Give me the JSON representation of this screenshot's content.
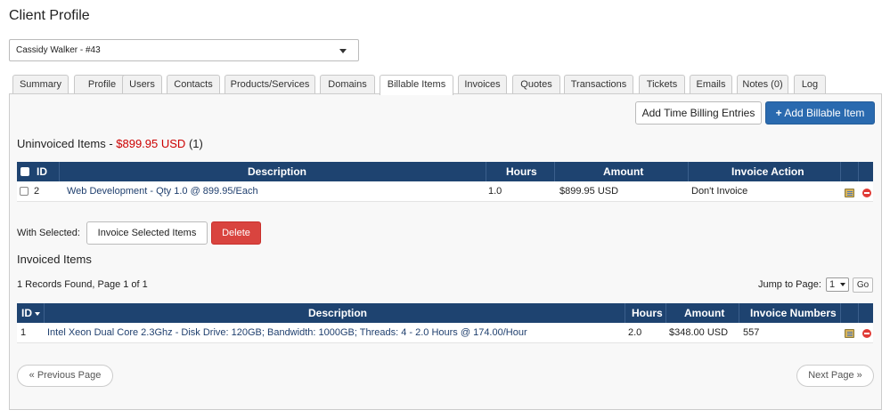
{
  "page_title": "Client Profile",
  "client_selector": {
    "value": "Cassidy Walker - #43"
  },
  "tabs": [
    {
      "label": "Summary"
    },
    {
      "label": "Profile"
    },
    {
      "label": "Users"
    },
    {
      "label": "Contacts"
    },
    {
      "label": "Products/Services"
    },
    {
      "label": "Domains"
    },
    {
      "label": "Billable Items",
      "active": true
    },
    {
      "label": "Invoices"
    },
    {
      "label": "Quotes"
    },
    {
      "label": "Transactions"
    },
    {
      "label": "Tickets"
    },
    {
      "label": "Emails"
    },
    {
      "label": "Notes (0)"
    },
    {
      "label": "Log"
    }
  ],
  "toolbar": {
    "add_time_billing_label": "Add Time Billing Entries",
    "add_billable_item_label": "Add Billable Item",
    "add_billable_item_icon": "plus-icon"
  },
  "uninvoiced": {
    "title": "Uninvoiced Items - ",
    "amount": "$899.95 USD",
    "count": "(1)",
    "columns": {
      "id": "ID",
      "description": "Description",
      "hours": "Hours",
      "amount": "Amount",
      "action": "Invoice Action"
    },
    "rows": [
      {
        "id": "2",
        "description": "Web Development - Qty 1.0 @ 899.95/Each",
        "hours": "1.0",
        "amount": "$899.95 USD",
        "action": "Don't Invoice"
      }
    ]
  },
  "bulk": {
    "label": "With Selected:",
    "invoice_selected_label": "Invoice Selected Items",
    "delete_label": "Delete"
  },
  "invoiced": {
    "title": "Invoiced Items",
    "records_text": "1 Records Found, Page 1 of 1",
    "jump_label": "Jump to Page:",
    "page_value": "1",
    "go_label": "Go",
    "columns": {
      "id": "ID",
      "description": "Description",
      "hours": "Hours",
      "amount": "Amount",
      "invoice_numbers": "Invoice Numbers"
    },
    "rows": [
      {
        "id": "1",
        "description": "Intel Xeon Dual Core 2.3Ghz - Disk Drive: 120GB; Bandwidth: 1000GB; Threads: 4 - 2.0 Hours @ 174.00/Hour",
        "hours": "2.0",
        "amount": "$348.00 USD",
        "invoice_numbers": "557"
      }
    ]
  },
  "pagination": {
    "previous_label": "« Previous Page",
    "next_label": "Next Page »"
  },
  "colors": {
    "header_bg": "#1e4370",
    "primary": "#2a6aaf",
    "danger": "#d9443f",
    "amount_red": "#cc0000"
  }
}
